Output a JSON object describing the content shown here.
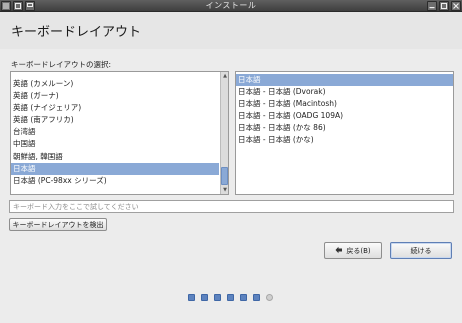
{
  "window": {
    "title": "インストール"
  },
  "header": {
    "title": "キーボードレイアウト"
  },
  "section": {
    "label": "キーボードレイアウトの選択:"
  },
  "layouts": {
    "items": [
      "英語 (カメルーン)",
      "英語 (ガーナ)",
      "英語 (ナイジェリア)",
      "英語 (南アフリカ)",
      "台湾語",
      "中国語",
      "朝鮮語, 韓国語",
      "日本語",
      "日本語 (PC-98xx シリーズ)"
    ],
    "selected": "日本語"
  },
  "variants": {
    "items": [
      "日本語",
      "日本語 - 日本語 (Dvorak)",
      "日本語 - 日本語 (Macintosh)",
      "日本語 - 日本語 (OADG 109A)",
      "日本語 - 日本語 (かな 86)",
      "日本語 - 日本語 (かな)"
    ],
    "selected": "日本語"
  },
  "test": {
    "placeholder": "キーボード入力をここで試してください"
  },
  "detect_button": {
    "label": "キーボードレイアウトを検出"
  },
  "nav": {
    "back_label": "戻る(B)",
    "continue_label": "続ける"
  },
  "progress": {
    "total_steps": 7,
    "completed_steps": 6
  },
  "colors": {
    "selection": "#8aa9d6",
    "titlebar": "#4a4a4a",
    "progress_done": "#5d83bf"
  }
}
